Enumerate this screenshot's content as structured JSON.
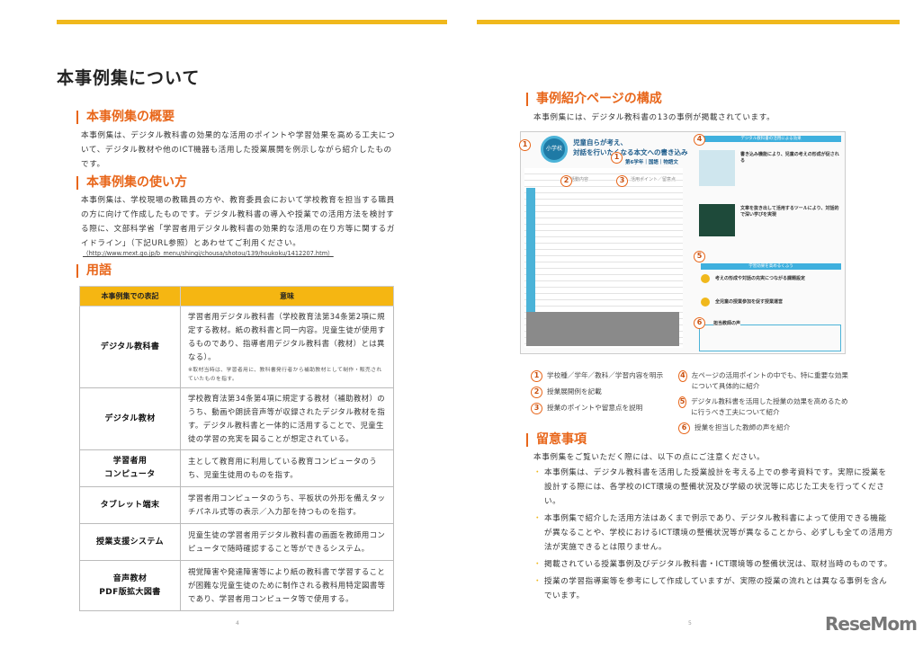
{
  "left": {
    "title": "本事例集について",
    "s1": {
      "heading": "本事例集の概要",
      "text": "本事例集は、デジタル教科書の効果的な活用のポイントや学習効果を高める工夫について、デジタル教材や他のICT機器も活用した授業展開を例示しながら紹介したものです。"
    },
    "s2": {
      "heading": "本事例集の使い方",
      "text": "本事例集は、学校現場の教職員の方や、教育委員会において学校教育を担当する職員の方に向けて作成したものです。デジタル教科書の導入や授業での活用方法を検討する際に、文部科学省「学習者用デジタル教科書の効果的な活用の在り方等に関するガイドライン」（下記URL参照）とあわせてご利用ください。",
      "url": "（http://www.mext.go.jp/b_menu/shingi/chousa/shotou/139/houkoku/1412207.htm）"
    },
    "s3": {
      "heading": "用語"
    },
    "table": {
      "headers": [
        "本事例集での表記",
        "意味"
      ],
      "rows": [
        {
          "term": "デジタル教科書",
          "meaning": "学習者用デジタル教科書（学校教育法第34条第2項に規定する教材。紙の教科書と同一内容。児童生徒が使用するものであり、指導者用デジタル教科書（教材）とは異なる）。",
          "note": "※取材当時は、学習者用に、教科書発行者から補助教材として制作・販売されていたものを指す。"
        },
        {
          "term": "デジタル教材",
          "meaning": "学校教育法第34条第4項に規定する教材（補助教材）のうち、動画や朗読音声等が収録されたデジタル教材を指す。デジタル教科書と一体的に活用することで、児童生徒の学習の充実を図ることが想定されている。"
        },
        {
          "term": "学習者用\nコンピュータ",
          "meaning": "主として教育用に利用している教育コンピュータのうち、児童生徒用のものを指す。"
        },
        {
          "term": "タブレット端末",
          "meaning": "学習者用コンピュータのうち、平板状の外形を備えタッチパネル式等の表示／入力部を持つものを指す。"
        },
        {
          "term": "授業支援システム",
          "meaning": "児童生徒の学習者用デジタル教科書の画面を教師用コンピュータで随時確認すること等ができるシステム。"
        },
        {
          "term": "音声教材\nPDF版拡大図書",
          "meaning": "視覚障害や発達障害等により紙の教科書で学習することが困難な児童生徒のために制作される教科用特定図書等であり、学習者用コンピュータ等で使用する。"
        }
      ]
    },
    "page_number": "4"
  },
  "right": {
    "s1": {
      "heading": "事例紹介ページの構成",
      "text": "本事例集には、デジタル教科書の13の事例が掲載されています。"
    },
    "thumb": {
      "badge": "小学校",
      "title1": "児童自らが考え、",
      "title2": "対話を行いたくなる本文への書き込み",
      "meta": "第6学年｜国語｜物語文",
      "col1": "活動内容",
      "col2": "活用ポイント／留意点",
      "band1": "デジタル教科書の活用による効果",
      "sub1": "書き込み機能により、児童の考えの形成が促される",
      "sub2": "文章を抜き出して活用するツールにより、対話的で深い学びを実現",
      "band2": "学習効果を高めるくふう",
      "k1": "考えの形成や対話の充実につながる課題設定",
      "k2": "全児童の授業参加を促す授業運営",
      "voice": "担当教師の声"
    },
    "legend": [
      {
        "n": "1",
        "text": "学校種／学年／教科／学習内容を明示"
      },
      {
        "n": "2",
        "text": "授業展開例を記載"
      },
      {
        "n": "3",
        "text": "授業のポイントや留意点を説明"
      },
      {
        "n": "4",
        "text": "左ページの活用ポイントの中でも、特に重要な効果について具体的に紹介"
      },
      {
        "n": "5",
        "text": "デジタル教科書を活用した授業の効果を高めるために行うべき工夫について紹介"
      },
      {
        "n": "6",
        "text": "授業を担当した教師の声を紹介"
      }
    ],
    "s2": {
      "heading": "留意事項",
      "intro": "本事例集をご覧いただく際には、以下の点にご注意ください。",
      "bullets": [
        "本事例集は、デジタル教科書を活用した授業設計を考える上での参考資料です。実際に授業を設計する際には、各学校のICT環境の整備状況及び学級の状況等に応じた工夫を行ってください。",
        "本事例集で紹介した活用方法はあくまで例示であり、デジタル教科書によって使用できる機能が異なることや、学校におけるICT環境の整備状況等が異なることから、必ずしも全ての活用方法が実施できるとは限りません。",
        "掲載されている授業事例及びデジタル教科書・ICT環境等の整備状況は、取材当時のものです。",
        "授業の学習指導案等を参考にして作成していますが、実際の授業の流れとは異なる事例を含んでいます。"
      ]
    },
    "page_number": "5"
  },
  "logo": "ReseMom",
  "colors": {
    "accent": "#e8661a",
    "bar": "#f0b81c"
  }
}
